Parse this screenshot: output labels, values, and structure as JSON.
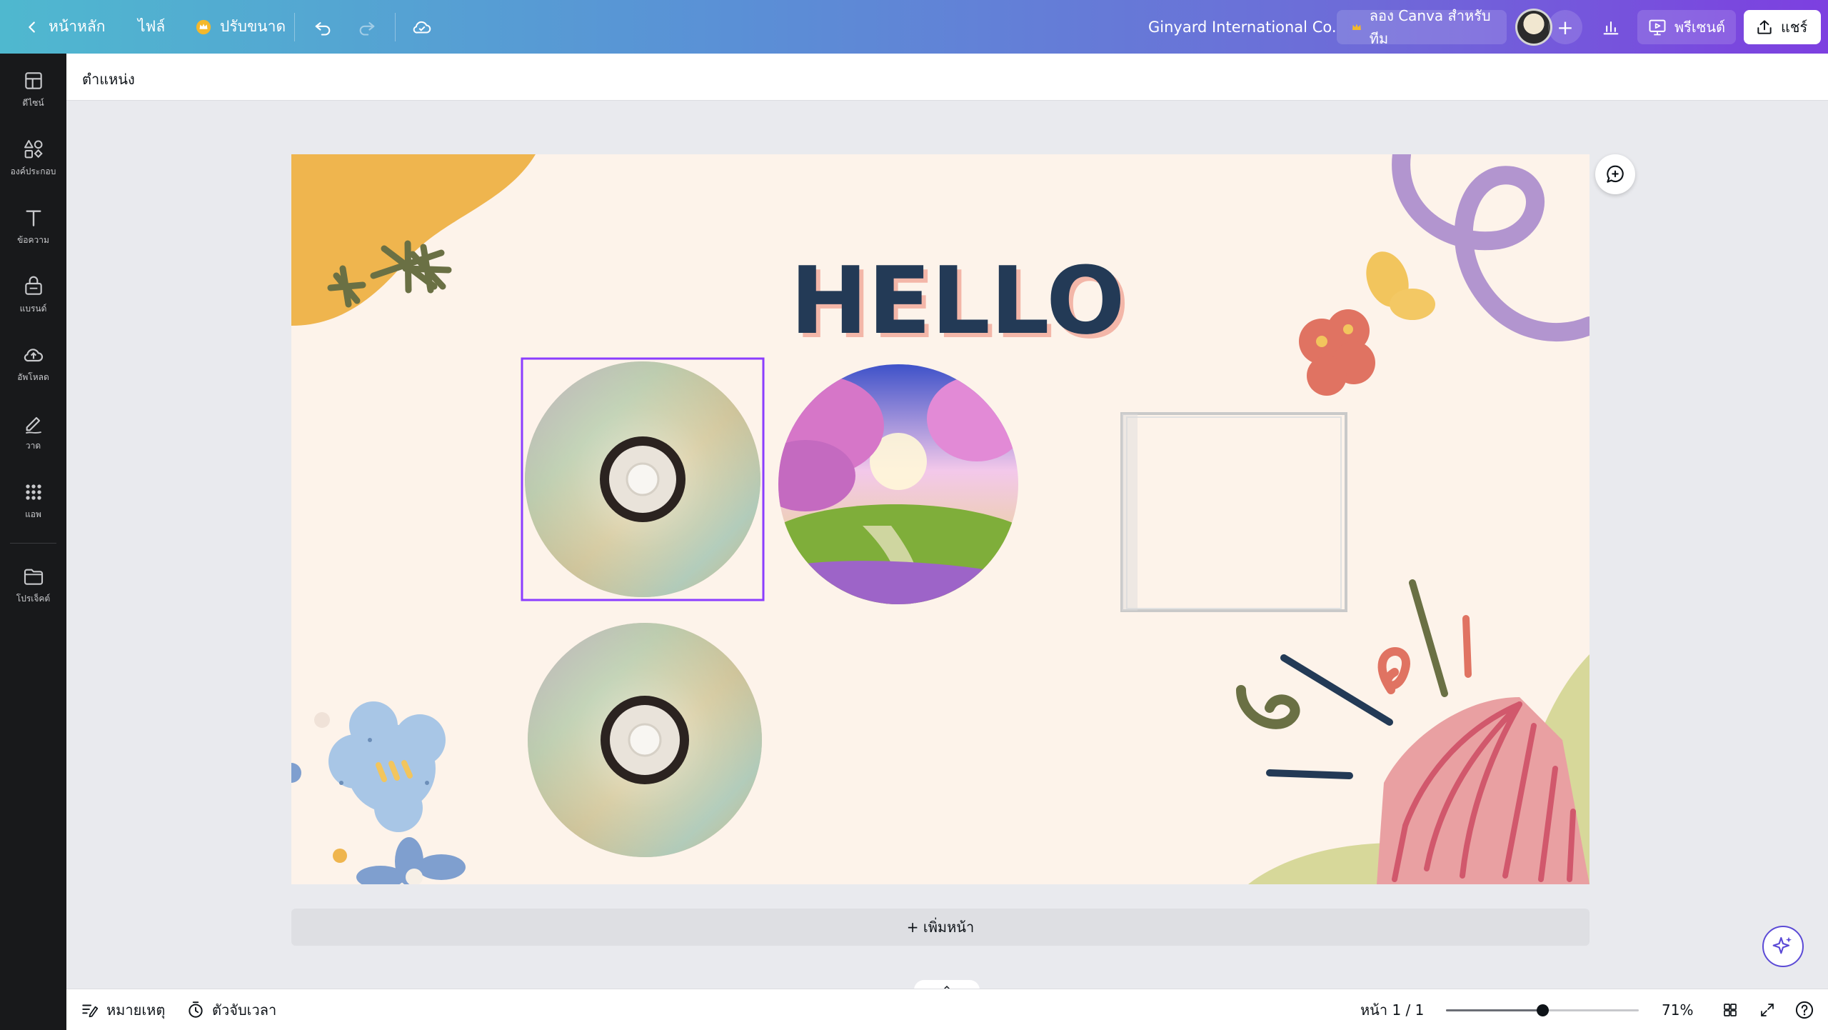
{
  "topbar": {
    "home_label": "หน้าหลัก",
    "file_label": "ไฟล์",
    "resize_label": "ปรับขนาด",
    "team_name": "Ginyard International Co.",
    "try_canva_label": "ลอง Canva สำหรับทีม",
    "present_label": "พรีเซนต์",
    "share_label": "แชร์"
  },
  "sidebar": {
    "items": [
      {
        "label": "ดีไซน์",
        "icon": "layout-icon"
      },
      {
        "label": "องค์ประกอบ",
        "icon": "shapes-icon"
      },
      {
        "label": "ข้อความ",
        "icon": "text-icon"
      },
      {
        "label": "แบรนด์",
        "icon": "brand-icon"
      },
      {
        "label": "อัพโหลด",
        "icon": "upload-icon"
      },
      {
        "label": "วาด",
        "icon": "pen-icon"
      },
      {
        "label": "แอพ",
        "icon": "apps-icon"
      },
      {
        "label": "โปรเจ็คต์",
        "icon": "folder-icon"
      }
    ]
  },
  "context_toolbar": {
    "position_label": "ตำแหน่ง"
  },
  "design": {
    "heading": "HELLO"
  },
  "add_page_label": "+ เพิ่มหน้า",
  "footer": {
    "notes_label": "หมายเหตุ",
    "timer_label": "ตัวจับเวลา",
    "page_indicator": "หน้า 1 / 1",
    "zoom_label": "71%",
    "zoom_value": 0.5
  },
  "colors": {
    "accent_purple": "#8b3dff",
    "canvas_bg": "#fdf3ea",
    "heading_color": "#233a56"
  }
}
